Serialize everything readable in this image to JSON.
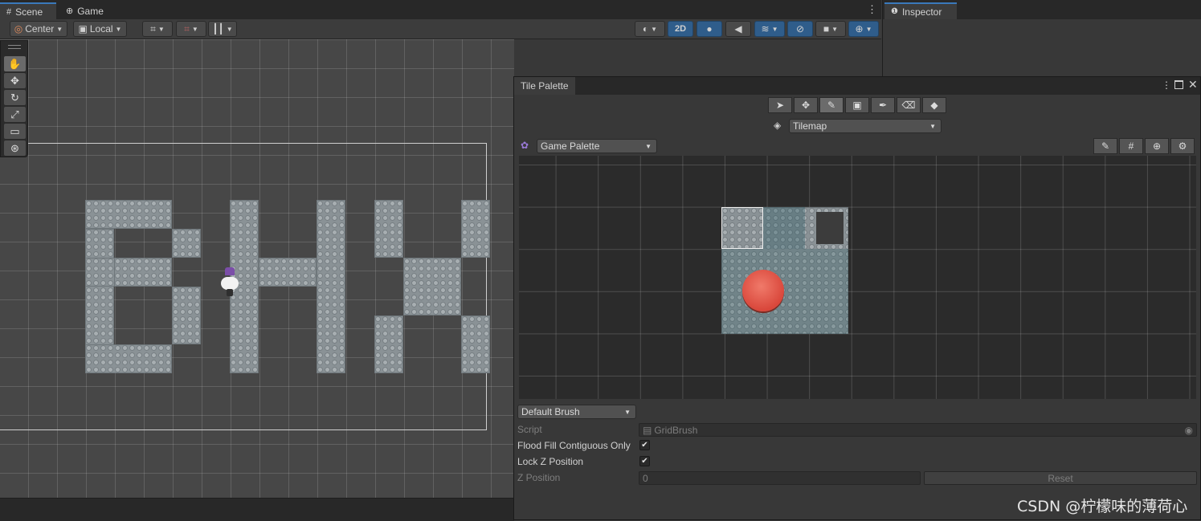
{
  "tabs": {
    "scene": "Scene",
    "game": "Game",
    "inspector": "Inspector"
  },
  "scene_toolbar": {
    "pivot_mode": "Center",
    "pivot_rotation": "Local",
    "mode_2d": "2D"
  },
  "tile_palette": {
    "title": "Tile Palette",
    "active_target": "Tilemap",
    "palette_name": "Game Palette",
    "brush": "Default Brush",
    "properties": {
      "script_label": "Script",
      "script_value": "GridBrush",
      "flood_fill_label": "Flood Fill Contiguous Only",
      "flood_fill_checked": true,
      "lock_z_label": "Lock Z Position",
      "lock_z_checked": true,
      "z_position_label": "Z Position",
      "z_position_value": "0",
      "reset_label": "Reset"
    }
  },
  "watermark": "CSDN @柠檬味的薄荷心",
  "colors": {
    "accent_blue": "#3a79bb",
    "active_button": "#2f5d8b",
    "scene_bg": "#474747",
    "palette_bg": "#2b2b2b",
    "tile_stone": "#8a9296",
    "red_button": "#e0574a"
  }
}
